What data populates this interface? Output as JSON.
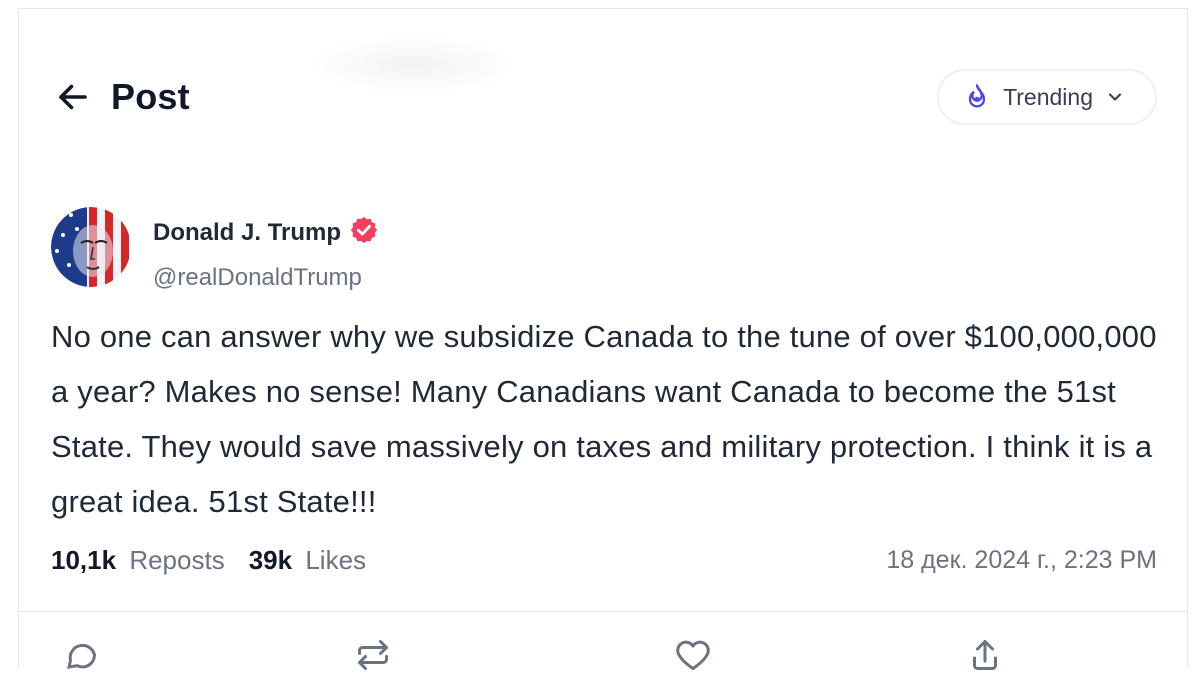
{
  "header": {
    "title": "Post",
    "trending_label": "Trending",
    "back_icon": "arrow-left-icon",
    "trending_icon": "fire-icon",
    "dropdown_icon": "chevron-down-icon"
  },
  "author": {
    "display_name": "Donald J. Trump",
    "handle": "@realDonaldTrump",
    "verified": true,
    "verified_color": "#f43f5e"
  },
  "post": {
    "text": "No one can answer why we subsidize Canada to the tune of over $100,000,000 a year? Makes no sense! Many Canadians want Canada to become the 51st State. They would save massively on taxes and military protection. I think it is a great idea. 51st State!!!"
  },
  "stats": {
    "reposts_count": "10,1k",
    "reposts_label": "Reposts",
    "likes_count": "39k",
    "likes_label": "Likes",
    "timestamp": "18 дек. 2024 г., 2:23 PM"
  },
  "actions": [
    "reply-icon",
    "repost-icon",
    "like-icon",
    "share-icon"
  ],
  "colors": {
    "accent": "#4f46e5",
    "text_primary": "#1f2937",
    "text_muted": "#6b7280",
    "border": "#e5e7eb"
  }
}
